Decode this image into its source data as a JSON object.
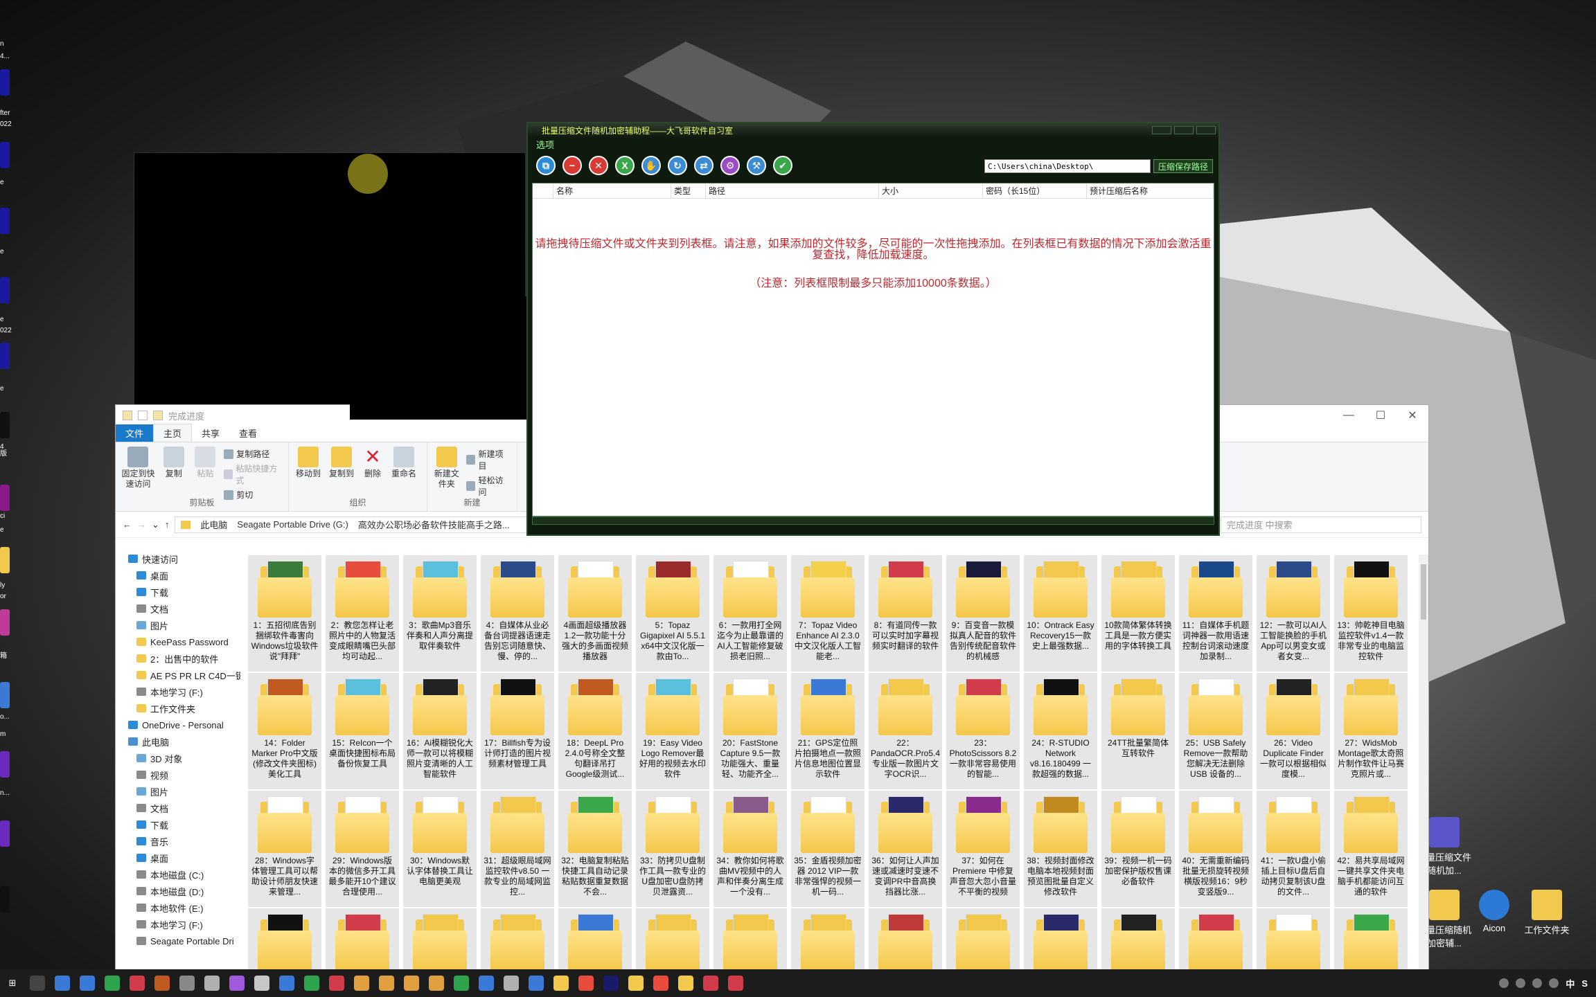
{
  "desktop": {
    "left_labels": [
      "n",
      "4...",
      "fter",
      "022",
      "e",
      "e",
      "e",
      "022",
      "e",
      "4",
      "版",
      "ci",
      "e",
      "ly",
      "or",
      "箱",
      "o...",
      "m",
      "n..."
    ],
    "right_icons": [
      {
        "label": "批量压缩文件随机加...",
        "color": "#5a56c9"
      },
      {
        "label": "批量压缩随机加密辅...",
        "color": "#f2c94c"
      },
      {
        "label": "Aicon",
        "color": "#2d7ad6"
      },
      {
        "label": "工作文件夹",
        "color": "#f2c94c"
      }
    ]
  },
  "compressor": {
    "title": "批量压缩文件随机加密辅助程——大飞哥软件自习室",
    "menu": "选项",
    "toolbar": [
      {
        "name": "copy-icon",
        "color": "#2c8bd6",
        "glyph": "⧉"
      },
      {
        "name": "remove-icon",
        "color": "#d83a34",
        "glyph": "−"
      },
      {
        "name": "close-icon",
        "color": "#d83a34",
        "glyph": "✕"
      },
      {
        "name": "excel-icon",
        "color": "#3aa84a",
        "glyph": "X"
      },
      {
        "name": "hand-icon",
        "color": "#3c8cd3",
        "glyph": "✋"
      },
      {
        "name": "refresh-icon",
        "color": "#3c8cd3",
        "glyph": "↻"
      },
      {
        "name": "shuffle-icon",
        "color": "#3c8cd3",
        "glyph": "⇄"
      },
      {
        "name": "settings-icon",
        "color": "#9b4bc5",
        "glyph": "⚙"
      },
      {
        "name": "tool-icon",
        "color": "#3c8cd3",
        "glyph": "⚒"
      },
      {
        "name": "check-icon",
        "color": "#3aa84a",
        "glyph": "✔"
      }
    ],
    "path_value": "C:\\Users\\china\\Desktop\\",
    "path_button": "压缩保存路径",
    "columns": [
      "名称",
      "类型",
      "路径",
      "大小",
      "密码（长15位）",
      "预计压缩后名称"
    ],
    "message": "请拖拽待压缩文件或文件夹到列表框。请注意，如果添加的文件较多，尽可能的一次性拖拽添加。在列表框已有数据的情况下添加会激活重复查找，降低加载速度。",
    "note": "（注意：列表框限制最多只能添加10000条数据。）"
  },
  "explorer": {
    "title": "完成进度",
    "tabs": [
      "文件",
      "主页",
      "共享",
      "查看"
    ],
    "ribbon": {
      "clipboard": {
        "name": "剪贴板",
        "pin": "固定到快速访问",
        "copy": "复制",
        "paste": "粘贴",
        "copy_path": "复制路径",
        "paste_shortcut": "粘贴快捷方式",
        "cut": "剪切"
      },
      "organize": {
        "name": "组织",
        "move": "移动到",
        "copyto": "复制到",
        "delete": "删除",
        "rename": "重命名"
      },
      "new": {
        "name": "新建",
        "folder": "新建文件夹",
        "item": "新建项目",
        "easy": "轻松访问"
      }
    },
    "breadcrumb": [
      "此电脑",
      "Seagate Portable Drive (G:)",
      "高效办公职场必备软件技能高手之路..."
    ],
    "search_placeholder": "完成进度 中搜索",
    "nav": [
      {
        "label": "快速访问",
        "icon": "#2c8bd6",
        "indent": 0
      },
      {
        "label": "桌面",
        "icon": "#2c8bd6",
        "indent": 1
      },
      {
        "label": "下载",
        "icon": "#2c8bd6",
        "indent": 1
      },
      {
        "label": "文档",
        "icon": "#8a8a8a",
        "indent": 1
      },
      {
        "label": "图片",
        "icon": "#6aa6d8",
        "indent": 1
      },
      {
        "label": "KeePass Password",
        "icon": "#f2c94c",
        "indent": 1
      },
      {
        "label": "2：出售中的软件",
        "icon": "#f2c94c",
        "indent": 1
      },
      {
        "label": "AE PS PR LR C4D一键",
        "icon": "#f2c94c",
        "indent": 1
      },
      {
        "label": "本地学习 (F:)",
        "icon": "#8a8a8a",
        "indent": 1
      },
      {
        "label": "工作文件夹",
        "icon": "#f2c94c",
        "indent": 1
      },
      {
        "label": "OneDrive - Personal",
        "icon": "#2c8bd6",
        "indent": 0
      },
      {
        "label": "此电脑",
        "icon": "#4a8fd0",
        "indent": 0
      },
      {
        "label": "3D 对象",
        "icon": "#6aa6d8",
        "indent": 1
      },
      {
        "label": "视频",
        "icon": "#8a8a8a",
        "indent": 1
      },
      {
        "label": "图片",
        "icon": "#6aa6d8",
        "indent": 1
      },
      {
        "label": "文档",
        "icon": "#8a8a8a",
        "indent": 1
      },
      {
        "label": "下载",
        "icon": "#2c8bd6",
        "indent": 1
      },
      {
        "label": "音乐",
        "icon": "#2c8bd6",
        "indent": 1
      },
      {
        "label": "桌面",
        "icon": "#2c8bd6",
        "indent": 1
      },
      {
        "label": "本地磁盘 (C:)",
        "icon": "#8a8a8a",
        "indent": 1
      },
      {
        "label": "本地磁盘 (D:)",
        "icon": "#8a8a8a",
        "indent": 1
      },
      {
        "label": "本地软件 (E:)",
        "icon": "#8a8a8a",
        "indent": 1
      },
      {
        "label": "本地学习 (F:)",
        "icon": "#8a8a8a",
        "indent": 1
      },
      {
        "label": "Seagate Portable Dri",
        "icon": "#8a8a8a",
        "indent": 1
      }
    ],
    "files": [
      "1：五招彻底告别捆绑软件毒害向Windows垃圾软件说\"拜拜\"",
      "2：教您怎样让老照片中的人物复活变成眼睛嘴巴头部均可动起...",
      "3：歌曲Mp3音乐伴奏和人声分离提取伴奏软件",
      "4：自媒体从业必备台词提器语速走告别忘词随意快、慢、停的...",
      "4画面超级播放器1.2一款功能十分强大的多画面视频播放器",
      "5：Topaz Gigapixel AI 5.5.1 x64中文汉化版一款由To...",
      "6：一款用打全网迄今为止最靠谱的AI人工智能修复破损老旧照...",
      "7：Topaz Video Enhance AI 2.3.0中文汉化版人工智能老...",
      "8：有道同传一款可以实时加字幕视频实时翻译的软件",
      "9：百变音一款模拟真人配音的软件告别传统配音软件的机械感",
      "10：Ontrack Easy Recovery15一款史上最强数据...",
      "10款简体繁体转换工具是一款方便实用的字体转换工具",
      "11：自媒体手机题词神器一款用语速控制台词滚动速度加录制...",
      "12：一款可以AI人工智能换脸的手机App可以男变女或者女变...",
      "13：帅乾神目电脑监控软件v1.4一款非常专业的电脑监控软件",
      "14：Folder Marker Pro中文版(修改文件夹图标)美化工具",
      "15：ReIcon一个桌面快捷图标布局备份恢复工具",
      "16：Ai模糊锐化大师一款可以将模糊照片变清晰的人工智能软件",
      "17：Billfish专为设计师打造的图片视频素材管理工具",
      "18：DeepL Pro 2.4.0号称全文整句翻译吊打Google级测试...",
      "19：Easy Video Logo Remover最好用的视频去水印软件",
      "20：FastStone Capture 9.5一款功能强大、重量轻、功能齐全...",
      "21：GPS定位照片拍摄地点一款照片信息地图位置显示软件",
      "22：PandaOCR.Pro5.4专业版一款图片文字OCR识...",
      "23：PhotoScissors 8.2 一款非常容易使用的智能...",
      "24：R-STUDIO Network v8.16.180499 一款超强的数据...",
      "24TT批量繁简体互转软件",
      "25：USB Safely Remove一款帮助您解决无法删除USB 设备的...",
      "26：Video Duplicate Finder一款可以根据相似度模...",
      "27：WidsMob Montage歌太奇照片制作软件让马赛克照片或...",
      "28：Windows字体管理工具可以帮助设计师朋友快速来管理...",
      "29：Windows版本的微信多开工具最多能开10个建议合理使用...",
      "30：Windows默认字体替换工具让电脑更美观",
      "31：超级眼局域网监控软件v8.50 一款专业的局域网监控...",
      "32：电脑复制粘贴快捷工具自动记录粘贴数据重复数据不会...",
      "33：防拷贝U盘制作工具一款专业的U盘加密U盘防拷贝泄露资...",
      "34：教你如何将歌曲MV视频中的人声和伴奏分离生成一个没有...",
      "35：金盾视频加密器 2012 VIP一款非常强悍的视频一机一码...",
      "36：如何让人声加速或减速时变速不变调PR中音高换挡器比涨...",
      "37：如何在Premiere 中修复声音忽大忽小音量不平衡的视频",
      "38：视频封面修改电脑本地视频封面预览图批量自定义修改软件",
      "39：视频一机一码加密保护版权售课必备软件",
      "40：无需重新编码批量无损旋转视频横版视频16：9秒变竖版9...",
      "41：一款U盘小偷插上目标U盘后自动拷贝复制该U盘的文件...",
      "42：易共享局域网一键共享文件夹电脑手机都能访问互通的软件",
      "",
      "",
      "",
      "",
      "",
      "",
      "",
      "",
      "",
      "",
      "",
      "",
      "",
      "",
      ""
    ],
    "file_colors": [
      "#3a7a3a",
      "#e74c3c",
      "#5bc0de",
      "#2a4a8a",
      "#ffffff",
      "#9b2b2b",
      "#ffffff",
      "#f5d04a",
      "#d23b4a",
      "#1a1a3a",
      "#f2c94c",
      "#f2c94c",
      "#1a4a8a",
      "#2a4a8a",
      "#111111",
      "#c05a20",
      "#5bc0de",
      "#222",
      "#111",
      "#c05a20",
      "#5bc0de",
      "#ffffff",
      "#3a7ad6",
      "#f2c94c",
      "#d23b4a",
      "#111",
      "#f2c94c",
      "#ffffff",
      "#222",
      "#f2c94c",
      "#ffffff",
      "#ffffff",
      "#ffffff",
      "#f2c94c",
      "#3aa84a",
      "#ffffff",
      "#8a5a8a",
      "#ffffff",
      "#2a2a6a",
      "#8a2a8a",
      "#c08a20",
      "#ffffff",
      "#ffffff",
      "#ffffff",
      "#f2c94c",
      "#111",
      "#d23b4a",
      "#f2c94c",
      "#f2c94c",
      "#3a7ad6",
      "#f2c94c",
      "#f2c94c",
      "#f2c94c",
      "#c03a3a",
      "#f2c94c",
      "#2a2a6a",
      "#222",
      "#d23b4a",
      "#ffffff",
      "#3aa84a"
    ]
  },
  "taskbar": {
    "icons": [
      "#444",
      "#3a7ad6",
      "#3a7ad6",
      "#2ea44f",
      "#d23b4a",
      "#c05a20",
      "#888",
      "#b0b0b0",
      "#a05adb",
      "#c7c7c7",
      "#3a7ad6",
      "#2ea44f",
      "#d23b4a",
      "#e0a040",
      "#e0a040",
      "#e0a040",
      "#e0a040",
      "#2ea44f",
      "#3a7ad6",
      "#b0b0b0",
      "#3a7ad6",
      "#f2c94c",
      "#e74c3c",
      "#1a1a6a",
      "#f2c94c",
      "#e74c3c",
      "#f2c94c",
      "#d23b4a",
      "#d23b4a"
    ],
    "tray_text": [
      "中",
      "S"
    ]
  }
}
